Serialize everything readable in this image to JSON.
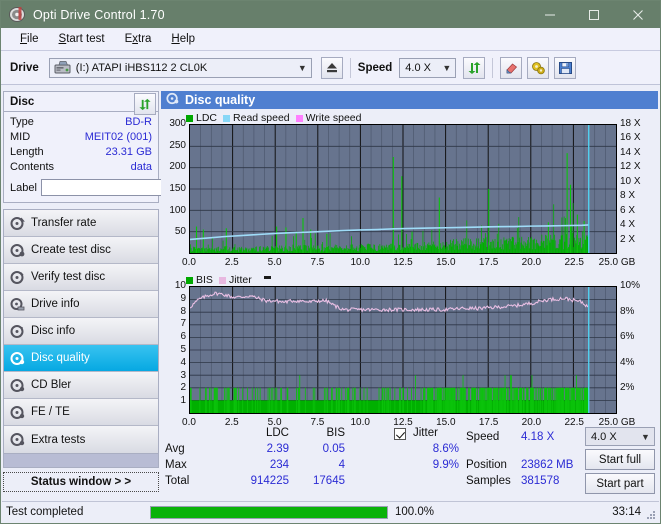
{
  "window": {
    "title": "Opti Drive Control 1.70",
    "icon": "disc-icon",
    "minimize": "—",
    "maximize": "☐",
    "close": "✕"
  },
  "menu": [
    {
      "label": "File",
      "accel": "F"
    },
    {
      "label": "Start test",
      "accel": "S"
    },
    {
      "label": "Extra",
      "accel": "x"
    },
    {
      "label": "Help",
      "accel": "H"
    }
  ],
  "toolbar": {
    "drive_label": "Drive",
    "drive_value": "(I:)  ATAPI iHBS112  2 CL0K",
    "eject_icon": "eject-icon",
    "speed_label": "Speed",
    "speed_value": "4.0 X",
    "refresh_icon": "refresh-icon",
    "eraser_icon": "eraser-icon",
    "settings_icon": "gears-icon",
    "save_icon": "floppy-save-icon"
  },
  "disc": {
    "header": "Disc",
    "refresh_icon": "refresh-icon",
    "rows": [
      {
        "key": "Type",
        "value": "BD-R"
      },
      {
        "key": "MID",
        "value": "MEIT02 (001)"
      },
      {
        "key": "Length",
        "value": "23.31 GB"
      },
      {
        "key": "Contents",
        "value": "data"
      }
    ],
    "label_key": "Label",
    "label_value": "",
    "label_placeholder": "",
    "disc_icon": "cd-disc-icon"
  },
  "nav": {
    "items": [
      {
        "label": "Transfer rate",
        "icon": "disc-rate-icon",
        "active": false
      },
      {
        "label": "Create test disc",
        "icon": "disc-create-icon",
        "active": false
      },
      {
        "label": "Verify test disc",
        "icon": "disc-verify-icon",
        "active": false
      },
      {
        "label": "Drive info",
        "icon": "drive-info-icon",
        "active": false
      },
      {
        "label": "Disc info",
        "icon": "disc-info-icon",
        "active": false
      },
      {
        "label": "Disc quality",
        "icon": "disc-quality-icon",
        "active": true
      },
      {
        "label": "CD Bler",
        "icon": "disc-bler-icon",
        "active": false
      },
      {
        "label": "FE / TE",
        "icon": "disc-fete-icon",
        "active": false
      },
      {
        "label": "Extra tests",
        "icon": "disc-extra-icon",
        "active": false
      }
    ],
    "status_window": "Status window > >"
  },
  "panel": {
    "title": "Disc quality",
    "title_icon": "disc-quality-icon"
  },
  "stats": {
    "col_ldc": "LDC",
    "col_bis": "BIS",
    "row_avg": "Avg",
    "row_max": "Max",
    "row_total": "Total",
    "ldc_avg": "2.39",
    "ldc_max": "234",
    "ldc_total": "914225",
    "bis_avg": "0.05",
    "bis_max": "4",
    "bis_total": "17645",
    "jitter_label": "Jitter",
    "jitter_checked": true,
    "jitter_avg": "8.6%",
    "jitter_max": "9.9%",
    "speed_label": "Speed",
    "speed_value": "4.18 X",
    "position_label": "Position",
    "position_value": "23862 MB",
    "samples_label": "Samples",
    "samples_value": "381578",
    "speed_select": "4.0 X",
    "start_full": "Start full",
    "start_part": "Start part"
  },
  "statusbar": {
    "message": "Test completed",
    "progress_text": "100.0%",
    "progress_pct": 100,
    "elapsed": "33:14"
  },
  "colors": {
    "ldc_green": "#00a800",
    "read_speed_blue": "#87d7f7",
    "write_speed_pink": "#ff80ff",
    "jitter_pink": "#e8b8e0",
    "plot_bg": "#67748e",
    "accent_blue": "#4f7fd0",
    "value_blue": "#2b2bd4",
    "title_bar": "#677f6b"
  },
  "chart_data": [
    {
      "type": "line",
      "title": "Disc quality - LDC",
      "legend": [
        {
          "label": "LDC",
          "color": "#00a800"
        },
        {
          "label": "Read speed",
          "color": "#87d7f7"
        },
        {
          "label": "Write speed",
          "color": "#ff80ff"
        }
      ],
      "xlabel": "GB",
      "ylabel": "LDC",
      "y2label": "X",
      "xlim": [
        0,
        25.0
      ],
      "ylim": [
        0,
        300
      ],
      "y2lim": [
        0,
        18
      ],
      "xticks": [
        "0.0",
        "2.5",
        "5.0",
        "7.5",
        "10.0",
        "12.5",
        "15.0",
        "17.5",
        "20.0",
        "22.5",
        "25.0 GB"
      ],
      "yticks": [
        300,
        250,
        200,
        150,
        100,
        50
      ],
      "y2ticks": [
        "18 X",
        "16 X",
        "14 X",
        "12 X",
        "10 X",
        "8 X",
        "6 X",
        "4 X",
        "2 X"
      ],
      "grid": true,
      "series": [
        {
          "name": "Read speed",
          "color": "#87d7f7",
          "unit": "X",
          "x": [
            0.0,
            1.0,
            2.0,
            3.0,
            4.0,
            5.0,
            6.0,
            7.0,
            8.0,
            9.0,
            10.0,
            11.0,
            12.0,
            13.0,
            14.0,
            15.0,
            16.0,
            17.0,
            18.0,
            19.0,
            20.0,
            21.0,
            22.0,
            23.0,
            23.4
          ],
          "values": [
            1.9,
            2.1,
            2.3,
            2.45,
            2.6,
            2.75,
            2.85,
            2.95,
            3.05,
            3.15,
            3.25,
            3.3,
            3.4,
            3.45,
            3.5,
            3.55,
            3.6,
            3.65,
            3.7,
            3.72,
            3.78,
            3.8,
            3.85,
            3.9,
            3.95
          ]
        },
        {
          "name": "LDC",
          "color": "#00a800",
          "unit": "errors",
          "description": "Dense green spike band, baseline ~5-20, rising density after 14 GB",
          "baseline": [
            8,
            8,
            9,
            9,
            9,
            10,
            10,
            10,
            11,
            11,
            12,
            12,
            13,
            14,
            16,
            18,
            19,
            20,
            21,
            22,
            23,
            24,
            26,
            28
          ],
          "peaks": [
            {
              "x": 0.35,
              "y": 62
            },
            {
              "x": 0.75,
              "y": 55
            },
            {
              "x": 2.1,
              "y": 58
            },
            {
              "x": 5.05,
              "y": 62
            },
            {
              "x": 5.6,
              "y": 60
            },
            {
              "x": 6.2,
              "y": 50
            },
            {
              "x": 6.6,
              "y": 82
            },
            {
              "x": 7.05,
              "y": 55
            },
            {
              "x": 8.0,
              "y": 45
            },
            {
              "x": 11.9,
              "y": 225
            },
            {
              "x": 12.4,
              "y": 180
            },
            {
              "x": 13.0,
              "y": 50
            },
            {
              "x": 14.6,
              "y": 130
            },
            {
              "x": 17.5,
              "y": 150
            },
            {
              "x": 21.0,
              "y": 72
            },
            {
              "x": 22.1,
              "y": 234
            },
            {
              "x": 22.3,
              "y": 160
            },
            {
              "x": 22.7,
              "y": 90
            },
            {
              "x": 23.1,
              "y": 75
            }
          ]
        }
      ]
    },
    {
      "type": "line",
      "title": "Disc quality - BIS / Jitter",
      "legend": [
        {
          "label": "BIS",
          "color": "#00a800"
        },
        {
          "label": "Jitter",
          "color": "#e8b8e0"
        }
      ],
      "xlabel": "GB",
      "ylabel": "BIS",
      "y2label": "%",
      "xlim": [
        0,
        25.0
      ],
      "ylim": [
        0,
        10
      ],
      "y2lim": [
        0,
        10
      ],
      "xticks": [
        "0.0",
        "2.5",
        "5.0",
        "7.5",
        "10.0",
        "12.5",
        "15.0",
        "17.5",
        "20.0",
        "22.5",
        "25.0 GB"
      ],
      "yticks": [
        10,
        9,
        8,
        7,
        6,
        5,
        4,
        3,
        2,
        1
      ],
      "y2ticks": [
        "10%",
        "8%",
        "6%",
        "4%",
        "2%"
      ],
      "grid": true,
      "series": [
        {
          "name": "Jitter",
          "color": "#e8b8e0",
          "unit": "%",
          "x": [
            0.0,
            0.5,
            1.0,
            1.5,
            2.0,
            2.5,
            3.0,
            3.5,
            4.0,
            4.5,
            5.0,
            5.5,
            6.0,
            6.5,
            7.0,
            7.5,
            8.0,
            8.5,
            9.0,
            10.0,
            11.0,
            12.0,
            13.0,
            14.0,
            15.0,
            16.0,
            17.0,
            18.0,
            19.0,
            20.0,
            21.0,
            22.0,
            23.0,
            23.4
          ],
          "values": [
            8.4,
            9.0,
            9.3,
            9.5,
            9.4,
            9.2,
            9.2,
            9.3,
            9.1,
            8.9,
            8.9,
            8.8,
            8.9,
            8.9,
            8.8,
            8.9,
            8.9,
            8.5,
            8.2,
            8.2,
            8.2,
            8.2,
            8.2,
            8.2,
            8.2,
            8.3,
            8.3,
            8.4,
            8.5,
            8.7,
            9.0,
            9.1,
            8.8,
            8.4
          ]
        },
        {
          "name": "BIS",
          "color": "#00a800",
          "unit": "errors",
          "description": "Solid green band at 1, frequent spikes to 2, occasional to 3",
          "baseline": 1,
          "spike_levels": [
            2,
            3
          ]
        }
      ]
    }
  ]
}
